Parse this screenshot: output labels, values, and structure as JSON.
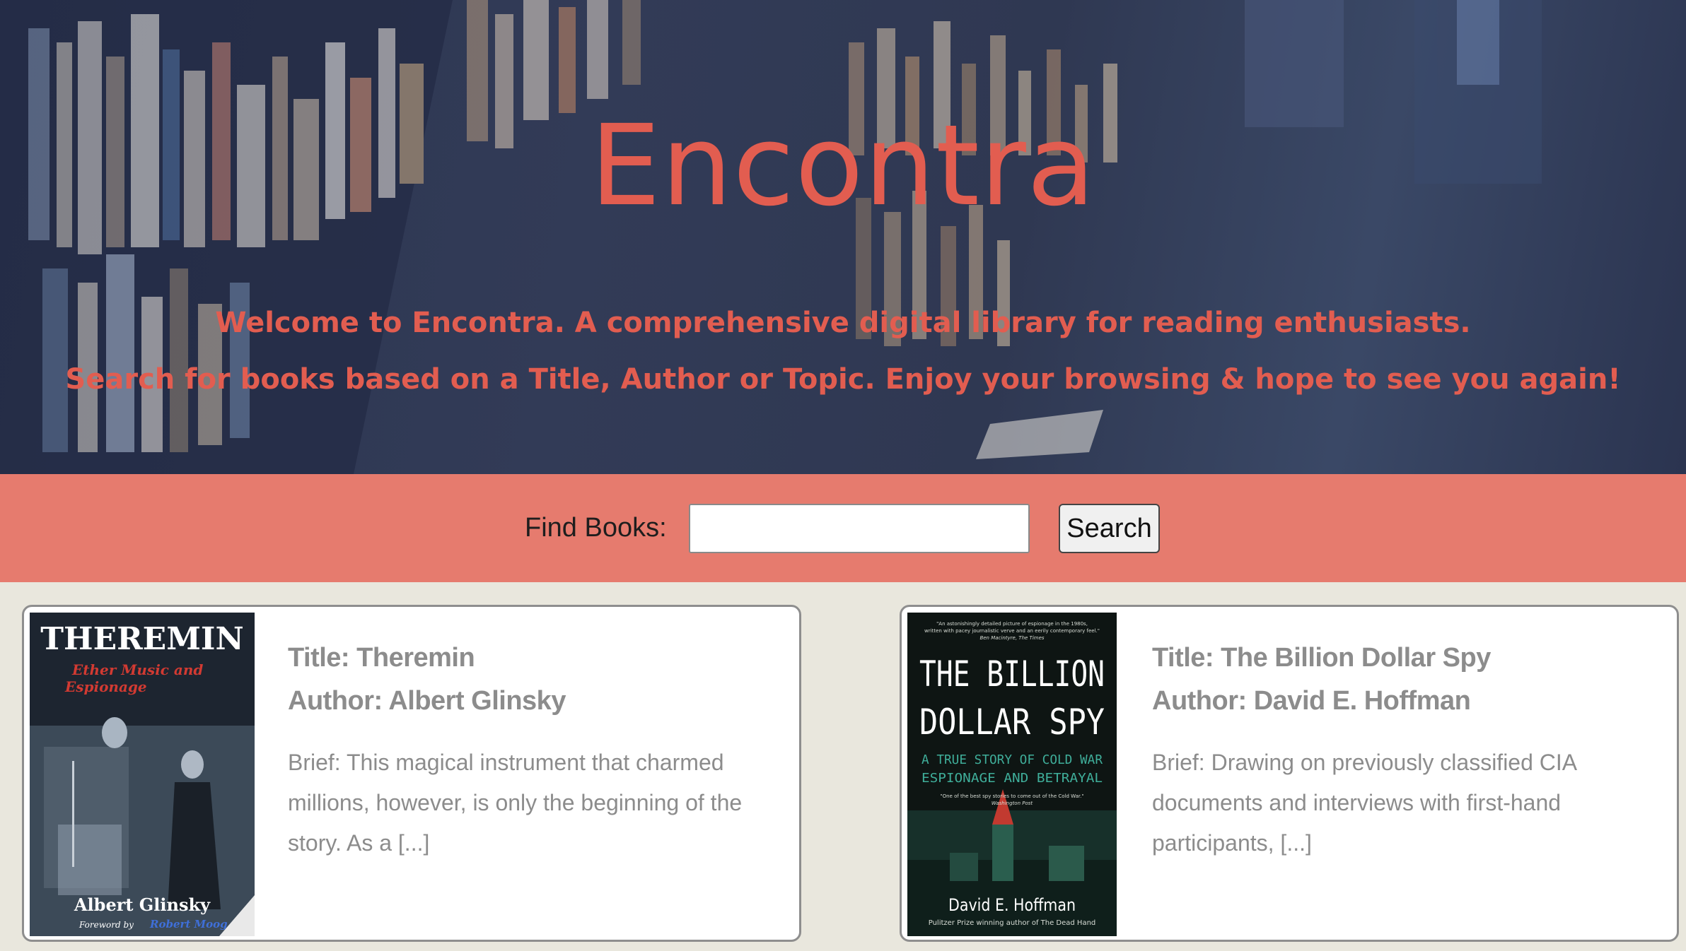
{
  "hero": {
    "title": "Encontra",
    "line1": "Welcome to Encontra. A comprehensive digital library for reading enthusiasts.",
    "line2": "Search for books based on a Title, Author or Topic. Enjoy your browsing & hope to see you again!"
  },
  "search": {
    "label": "Find Books:",
    "value": "",
    "placeholder": "",
    "button_label": "Search"
  },
  "books": [
    {
      "title": "Title: Theremin",
      "author": "Author: Albert Glinsky",
      "brief": "Brief: This magical instrument that charmed millions, however, is only the beginning of the story. As a [...]",
      "cover": {
        "title": "THEREMIN",
        "subtitle_1": "Ether Music and",
        "subtitle_2": "Espionage",
        "author": "Albert Glinsky",
        "foreword_label": "Foreword by",
        "foreword_name": "Robert Moog"
      }
    },
    {
      "title": "Title: The Billion Dollar Spy",
      "author": "Author: David E. Hoffman",
      "brief": "Brief: Drawing on previously classified CIA documents and interviews with first-hand participants, [...]",
      "cover": {
        "blurb_1": "\"An astonishingly detailed picture of espionage in the 1980s,",
        "blurb_2": "written with pacey journalistic verve and an eerily contemporary feel.\"",
        "blurb_source": "Ben Macintyre, The Times",
        "title_1": "THE BILLION",
        "title_2": "DOLLAR SPY",
        "subtitle_1": "A TRUE STORY OF COLD WAR",
        "subtitle_2": "ESPIONAGE AND BETRAYAL",
        "quote": "\"One of the best spy stories to come out of the Cold War.\"",
        "quote_source": "Washington Post",
        "author": "David E. Hoffman",
        "tagline": "Pulitzer Prize winning author of The Dead Hand"
      }
    }
  ]
}
